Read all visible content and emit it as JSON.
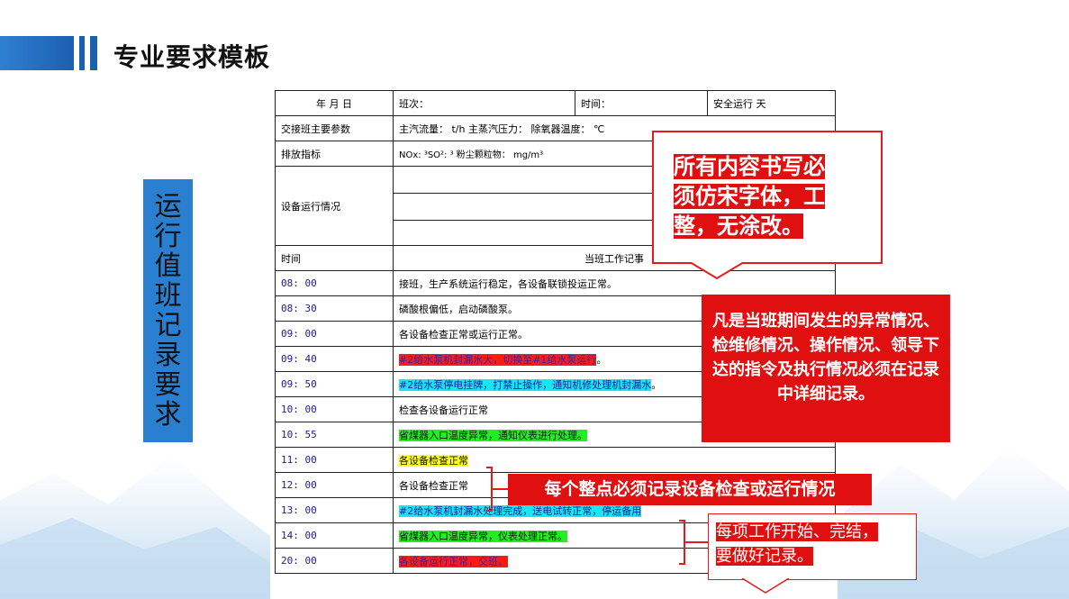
{
  "header": {
    "title": "专业要求模板"
  },
  "side_label": "运行值班记录要求",
  "table": {
    "row1": [
      "年 月 日",
      "班次：",
      "时间：",
      "安全运行 天"
    ],
    "params": {
      "label": "交接班主要参数",
      "value": "主汽流量： t/h 主蒸汽压力： 除氧器温度： ℃"
    },
    "emission": {
      "label": "排放指标",
      "value": "NOx: ³SO²: ³ 粉尘颗粒物： mg/m³"
    },
    "equipment": {
      "label": "设备运行情况"
    },
    "log_header": {
      "time": "时间",
      "record": "当班工作记事"
    },
    "entries": [
      {
        "time": "08: 00",
        "text": "接班，生产系统运行稳定，各设备联锁投运正常。",
        "hl": ""
      },
      {
        "time": "08: 30",
        "text": "磷酸根偏低，启动磷酸泵。",
        "hl": ""
      },
      {
        "time": "09: 00",
        "text": "各设备检查正常或运行正常。",
        "hl": ""
      },
      {
        "time": "09: 40",
        "text": "#2给水泵机封漏水大，切换至#1给水泵运行",
        "hl": "red",
        "suffix": "。"
      },
      {
        "time": "09: 50",
        "text": "#2给水泵停电挂牌，打禁止操作，通知机修处理机封漏水",
        "hl": "cyan",
        "suffix": "。"
      },
      {
        "time": "10: 00",
        "text": "检查各设备运行正常",
        "hl": ""
      },
      {
        "time": "10: 55",
        "text": "省煤器入口温度异常，通知仪表进行处理。",
        "hl": "green"
      },
      {
        "time": "11: 00",
        "text": "各设备检查正常",
        "hl": "yellow"
      },
      {
        "time": "12: 00",
        "text": "各设备检查正常",
        "hl": ""
      },
      {
        "time": "13: 00",
        "text": "#2给水泵机封漏水处理完成，送电试转正常，停运备用",
        "hl": "cyan"
      },
      {
        "time": "14: 00",
        "text": "省煤器入口温度异常，仪表处理正常。",
        "hl": "green"
      },
      {
        "time": "20: 00",
        "text": "各设备运行正常，交班。",
        "hl": "red"
      }
    ]
  },
  "callouts": {
    "font_rule": [
      "所有内容书写必",
      "须仿宋字体，工",
      "整，无涂改。"
    ],
    "abnormal": "凡是当班期间发生的异常情况、检维修情况、操作情况、领导下达的指令及执行情况必须在记录中详细记录。",
    "hourly": "每个整点必须记录设备检查或运行情况",
    "work": [
      "每项工作开始、完结，",
      "要做好记录。"
    ]
  },
  "colors": {
    "accent_blue": "#2a7fd0",
    "callout_red": "#e01010"
  }
}
